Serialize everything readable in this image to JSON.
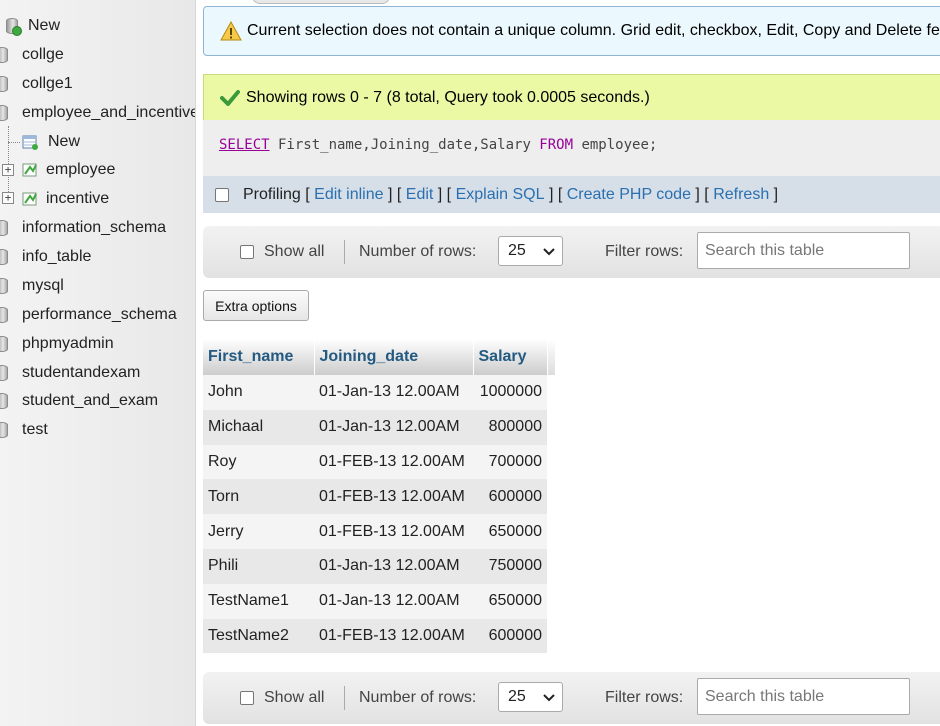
{
  "sidebar": {
    "items": [
      {
        "label": "New",
        "type": "new-db"
      },
      {
        "label": "collge",
        "type": "db"
      },
      {
        "label": "collge1",
        "type": "db"
      },
      {
        "label": "employee_and_incentive",
        "type": "db"
      },
      {
        "label": "New",
        "type": "new-table"
      },
      {
        "label": "employee",
        "type": "table"
      },
      {
        "label": "incentive",
        "type": "table"
      },
      {
        "label": "information_schema",
        "type": "db"
      },
      {
        "label": "info_table",
        "type": "db"
      },
      {
        "label": "mysql",
        "type": "db"
      },
      {
        "label": "performance_schema",
        "type": "db"
      },
      {
        "label": "phpmyadmin",
        "type": "db"
      },
      {
        "label": "studentandexam",
        "type": "db"
      },
      {
        "label": "student_and_exam",
        "type": "db"
      },
      {
        "label": "test",
        "type": "db"
      }
    ]
  },
  "notice": {
    "text": "Current selection does not contain a unique column. Grid edit, checkbox, Edit, Copy and Delete features are not available.",
    "icon": "warning-icon"
  },
  "success": {
    "text": "Showing rows 0 - 7 (8 total, Query took 0.0005 seconds.)",
    "icon": "check-icon"
  },
  "sql": {
    "select": "SELECT",
    "columns": " First_name,Joining_date,Salary ",
    "from": "FROM",
    "rest": " employee;"
  },
  "profiling": {
    "label": "Profiling",
    "bracket_open": " [ ",
    "sep": " ] [ ",
    "bracket_close": " ]",
    "links": [
      "Edit inline",
      "Edit",
      "Explain SQL",
      "Create PHP code",
      "Refresh"
    ]
  },
  "navbar": {
    "show_all": "Show all",
    "rows_label": "Number of rows:",
    "rows_value": "25",
    "filter_label": "Filter rows:",
    "filter_placeholder": "Search this table"
  },
  "extra_options": "Extra options",
  "results": {
    "columns": [
      "First_name",
      "Joining_date",
      "Salary"
    ],
    "rows": [
      [
        "John",
        "01-Jan-13 12.00AM",
        "1000000"
      ],
      [
        "Michaal",
        "01-Jan-13 12.00AM",
        "800000"
      ],
      [
        "Roy",
        "01-FEB-13 12.00AM",
        "700000"
      ],
      [
        "Torn",
        "01-FEB-13 12.00AM",
        "600000"
      ],
      [
        "Jerry",
        "01-FEB-13 12.00AM",
        "650000"
      ],
      [
        "Phili",
        "01-Jan-13 12.00AM",
        "750000"
      ],
      [
        "TestName1",
        "01-Jan-13 12.00AM",
        "650000"
      ],
      [
        "TestName2",
        "01-FEB-13 12.00AM",
        "600000"
      ]
    ]
  },
  "colors": {
    "link": "#2a6fb0",
    "header_text": "#235a81",
    "success_bg": "#ebf8a4",
    "notice_bg": "#ebf8fd",
    "sql_keyword": "#990099"
  }
}
